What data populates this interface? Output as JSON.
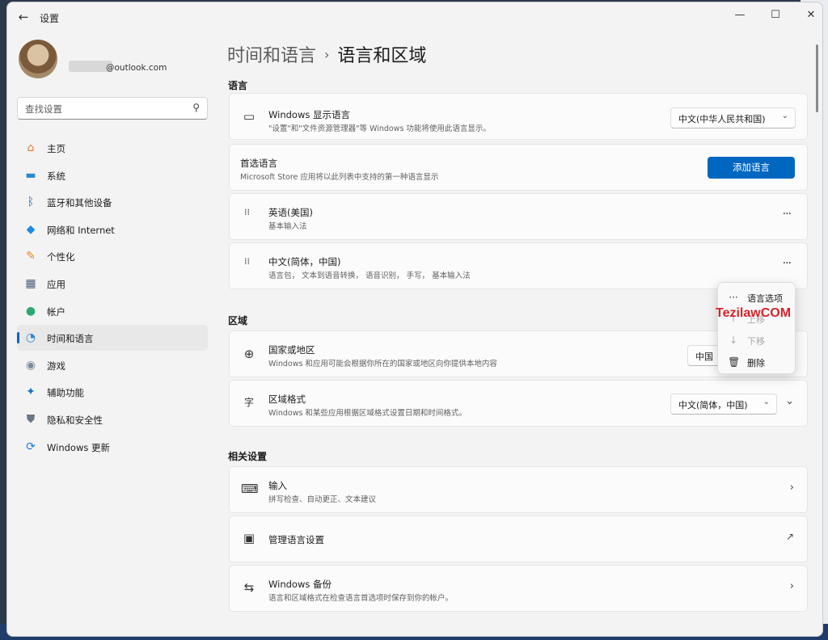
{
  "app": {
    "title": "设置",
    "back_icon": "arrow-left-icon",
    "min_glyph": "—",
    "max_glyph": "☐",
    "close_glyph": "✕"
  },
  "account": {
    "email": "@outlook.com"
  },
  "search": {
    "placeholder": "查找设置",
    "icon": "search-icon"
  },
  "sidebar": {
    "items": [
      {
        "label": "主页",
        "icon": "home-icon",
        "glyph": "⌂",
        "color": "#e07a2e"
      },
      {
        "label": "系统",
        "icon": "system-icon",
        "glyph": "▬",
        "color": "#2a8ad4"
      },
      {
        "label": "蓝牙和其他设备",
        "icon": "bluetooth-icon",
        "glyph": "ᛒ",
        "color": "#1565c0"
      },
      {
        "label": "网络和 Internet",
        "icon": "wifi-icon",
        "glyph": "◆",
        "color": "#1e88e5"
      },
      {
        "label": "个性化",
        "icon": "brush-icon",
        "glyph": "✎",
        "color": "#e88a20"
      },
      {
        "label": "应用",
        "icon": "apps-icon",
        "glyph": "▦",
        "color": "#4a5d78"
      },
      {
        "label": "帐户",
        "icon": "account-icon",
        "glyph": "●",
        "color": "#2aa872"
      },
      {
        "label": "时间和语言",
        "icon": "time-language-icon",
        "glyph": "◔",
        "color": "#2a8ad4"
      },
      {
        "label": "游戏",
        "icon": "gaming-icon",
        "glyph": "◉",
        "color": "#7b8a9a"
      },
      {
        "label": "辅助功能",
        "icon": "accessibility-icon",
        "glyph": "✦",
        "color": "#1a73c8"
      },
      {
        "label": "隐私和安全性",
        "icon": "shield-icon",
        "glyph": "⛊",
        "color": "#6b7785"
      },
      {
        "label": "Windows 更新",
        "icon": "update-icon",
        "glyph": "⟳",
        "color": "#1e7bd6"
      }
    ],
    "active_index": 7
  },
  "breadcrumb": {
    "parent": "时间和语言",
    "separator": "›",
    "current": "语言和区域"
  },
  "sections": {
    "language": "语言",
    "region": "区域",
    "related": "相关设置"
  },
  "language": {
    "display": {
      "title": "Windows 显示语言",
      "subtitle": "\"设置\"和\"文件资源管理器\"等 Windows 功能将使用此语言显示。",
      "value": "中文(中华人民共和国)",
      "icon": "monitor-icon"
    },
    "preferred": {
      "title": "首选语言",
      "subtitle": "Microsoft Store 应用将以此列表中支持的第一种语言显示",
      "button": "添加语言"
    },
    "items": [
      {
        "title": "英语(美国)",
        "subtitle": "基本输入法"
      },
      {
        "title": "中文(简体，中国)",
        "subtitle": "语言包， 文本到语音转换， 语音识别， 手写， 基本输入法"
      }
    ]
  },
  "region": {
    "country": {
      "title": "国家或地区",
      "subtitle": "Windows 和应用可能会根据你所在的国家或地区向你提供本地内容",
      "value": "中国",
      "icon": "globe-icon"
    },
    "format": {
      "title": "区域格式",
      "subtitle": "Windows 和某些应用根据区域格式设置日期和时间格式。",
      "value": "中文(简体，中国)",
      "icon": "regional-format-icon"
    }
  },
  "related": {
    "items": [
      {
        "title": "输入",
        "subtitle": "拼写检查、自动更正、文本建议",
        "icon": "keyboard-icon"
      },
      {
        "title": "管理语言设置",
        "subtitle": "",
        "icon": "admin-language-icon"
      },
      {
        "title": "Windows 备份",
        "subtitle": "语言和区域格式在检查语言首选项时保存到你的帐户。",
        "icon": "backup-icon"
      }
    ]
  },
  "context_menu": {
    "items": [
      {
        "label": "语言选项",
        "icon": "more-icon",
        "enabled": true
      },
      {
        "label": "上移",
        "icon": "arrow-up-icon",
        "enabled": false
      },
      {
        "label": "下移",
        "icon": "arrow-down-icon",
        "enabled": false
      },
      {
        "label": "删除",
        "icon": "trash-icon",
        "enabled": true
      }
    ]
  },
  "watermark": "TezilawCOM",
  "colors": {
    "accent": "#0067c0",
    "watermark": "#d8232a"
  }
}
